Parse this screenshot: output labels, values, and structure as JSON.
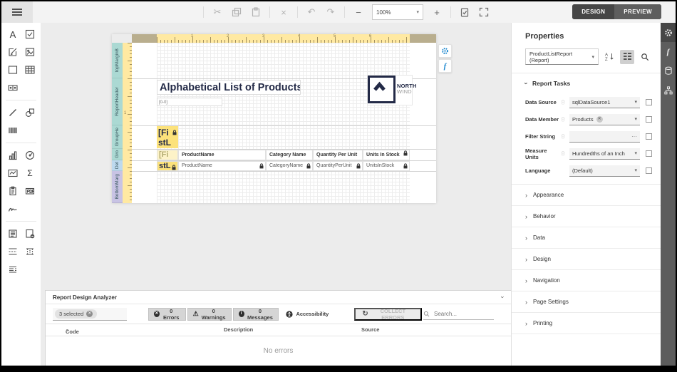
{
  "toolbar": {
    "zoom_value": "100%",
    "design_label": "DESIGN",
    "preview_label": "PREVIEW"
  },
  "designer": {
    "ruler_numbers": [
      "1",
      "2",
      "3",
      "4",
      "5",
      "6"
    ],
    "vruler_number": "1",
    "bands": [
      {
        "label": "topMarginB"
      },
      {
        "label": "ReportHeader"
      },
      {
        "label": "GroupHe"
      },
      {
        "label": "Gro"
      },
      {
        "label": "Det"
      },
      {
        "label": "BottomMarg"
      }
    ],
    "title": "Alphabetical List of Products",
    "small_field": "[0-0]",
    "logo": {
      "line1": "NORTH",
      "line2": "WIND"
    },
    "group_field": {
      "line1": "[Fi",
      "line2": "stL"
    },
    "group_cell_header": "[Fi",
    "group_cell_detail": "stL",
    "header_cells": [
      "ProductName",
      "Category Name",
      "Quantity Per Unit",
      "Units In Stock"
    ],
    "detail_cells": [
      "ProductName",
      "CategoryName",
      "QuantityPerUnit",
      "UnitsInStock"
    ]
  },
  "properties": {
    "title": "Properties",
    "selector_value": "ProductListReport (Report)",
    "tasks_section": "Report Tasks",
    "fields": [
      {
        "label": "Data Source",
        "value": "sqlDataSource1"
      },
      {
        "label": "Data Member",
        "value": "Products"
      },
      {
        "label": "Filter String",
        "value": "",
        "button": "···"
      },
      {
        "label": "Measure Units",
        "value": "Hundredths of an Inch"
      },
      {
        "label": "Language",
        "value": "(Default)"
      }
    ],
    "sections": [
      "Appearance",
      "Behavior",
      "Data",
      "Design",
      "Navigation",
      "Page Settings",
      "Printing"
    ]
  },
  "analyzer": {
    "title": "Report Design Analyzer",
    "selected_filter": "3 selected",
    "errors_label": "0 Errors",
    "warnings_label": "0 Warnings",
    "messages_label": "0 Messages",
    "accessibility_label": "Accessibility",
    "collect_label": "COLLECT ERRORS",
    "search_placeholder": "Search...",
    "col_code": "Code",
    "col_description": "Description",
    "col_source": "Source",
    "empty_message": "No errors"
  }
}
